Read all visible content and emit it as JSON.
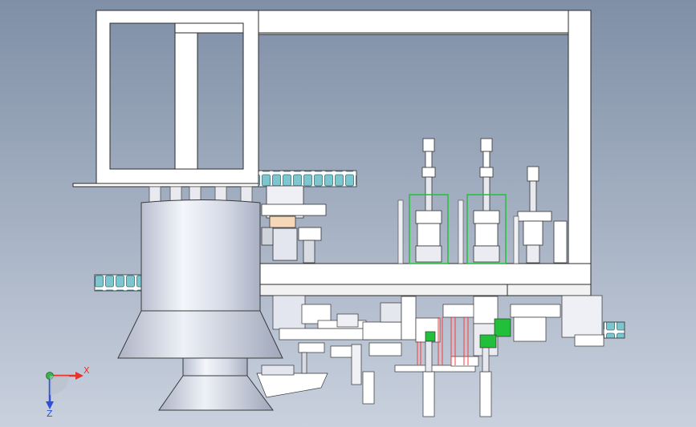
{
  "viewport": {
    "background_top": "#7f8fa6",
    "background_bottom": "#c9d1de"
  },
  "colors": {
    "frame_fill": "#ffffff",
    "frame_stroke": "#2b2b2b",
    "metal": "#d9dce3",
    "metal_dark": "#9aa2b1",
    "chain": "#7ec6cf",
    "green_part": "#22c03a",
    "red_beam": "#ff3a3a",
    "axis_x": "#e8322c",
    "axis_y": "#35b34a",
    "axis_z": "#2f4fd6"
  },
  "axis_triad": {
    "x_label": "X",
    "z_label": "Z"
  }
}
